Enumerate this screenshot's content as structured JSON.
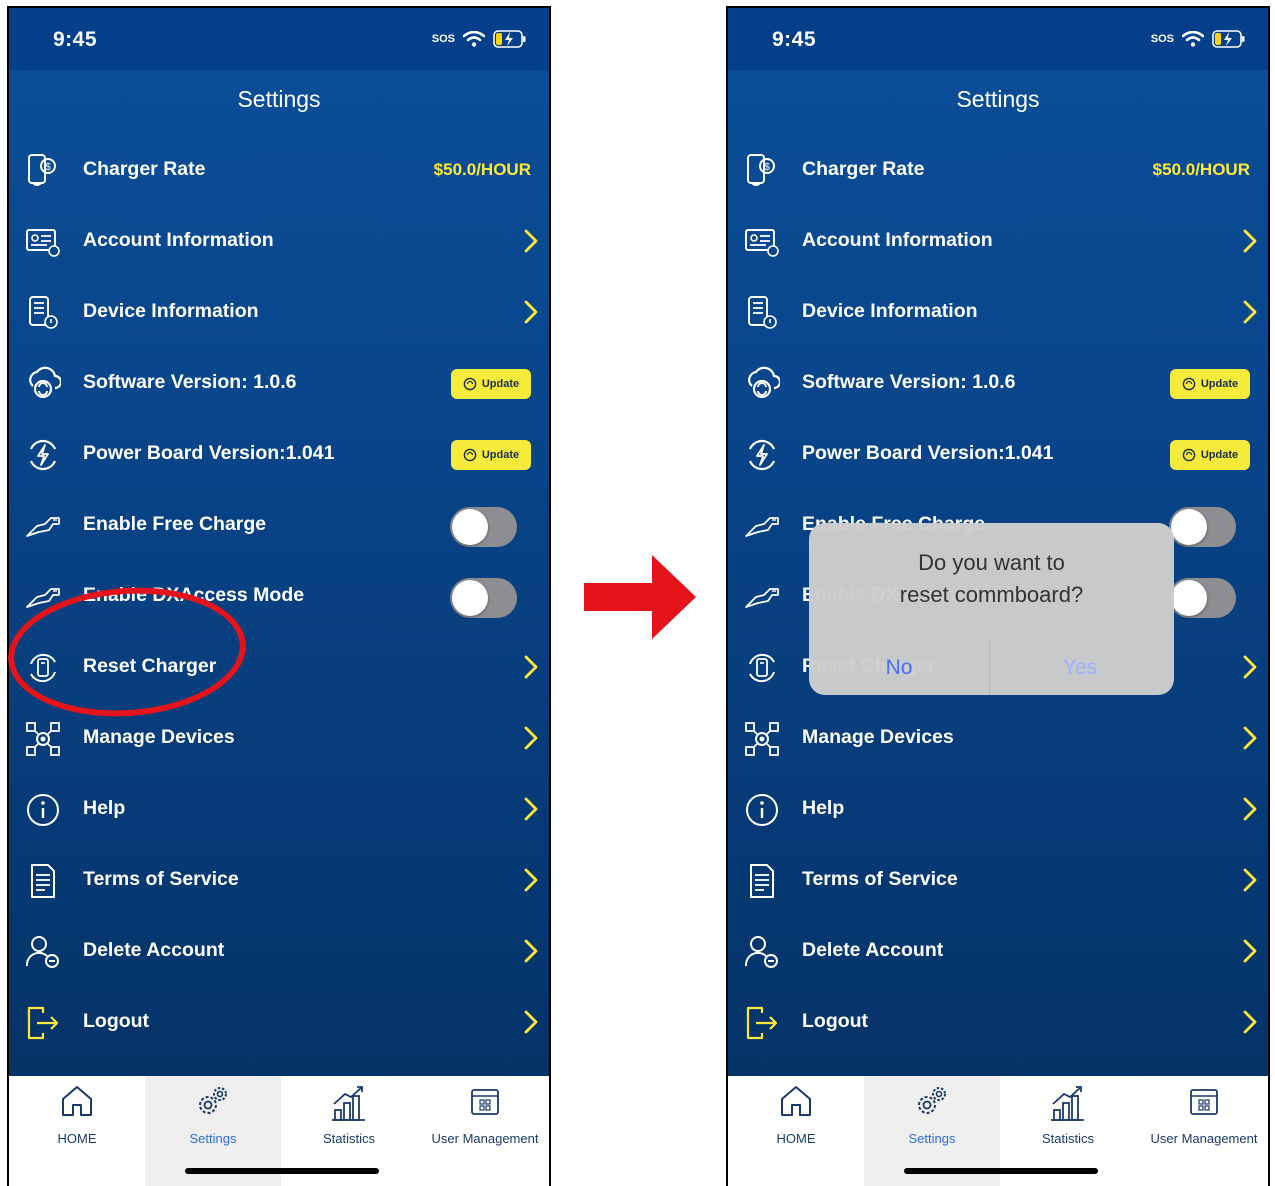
{
  "status": {
    "time": "9:45",
    "sos": "SOS"
  },
  "header": {
    "title": "Settings"
  },
  "settings": {
    "charger_rate": {
      "label": "Charger Rate",
      "value": "$50.0/HOUR"
    },
    "account_information": {
      "label": "Account Information"
    },
    "device_information": {
      "label": "Device Information"
    },
    "software_version": {
      "label": "Software Version: 1.0.6",
      "button": "Update"
    },
    "power_board_version": {
      "label": "Power Board Version:1.041",
      "button": "Update"
    },
    "enable_free_charge": {
      "label": "Enable Free Charge",
      "on": false
    },
    "enable_dxaccess_mode": {
      "label": "Enable DXAccess Mode",
      "on": false
    },
    "reset_charger": {
      "label": "Reset Charger"
    },
    "manage_devices": {
      "label": "Manage Devices"
    },
    "help": {
      "label": "Help"
    },
    "terms_of_service": {
      "label": "Terms of Service"
    },
    "delete_account": {
      "label": "Delete Account"
    },
    "logout": {
      "label": "Logout"
    }
  },
  "tabs": [
    {
      "label": "HOME",
      "icon": "home-icon"
    },
    {
      "label": "Settings",
      "icon": "gear-icon",
      "active": true
    },
    {
      "label": "Statistics",
      "icon": "statistics-icon"
    },
    {
      "label": "User Management",
      "icon": "user-management-icon"
    }
  ],
  "dialog": {
    "message_line1": "Do you want to",
    "message_line2": "reset commboard?",
    "no": "No",
    "yes": "Yes"
  },
  "colors": {
    "accent_yellow": "#ffe83a",
    "annotation_red": "#e5141b",
    "tab_active": "#2e6fd1"
  }
}
